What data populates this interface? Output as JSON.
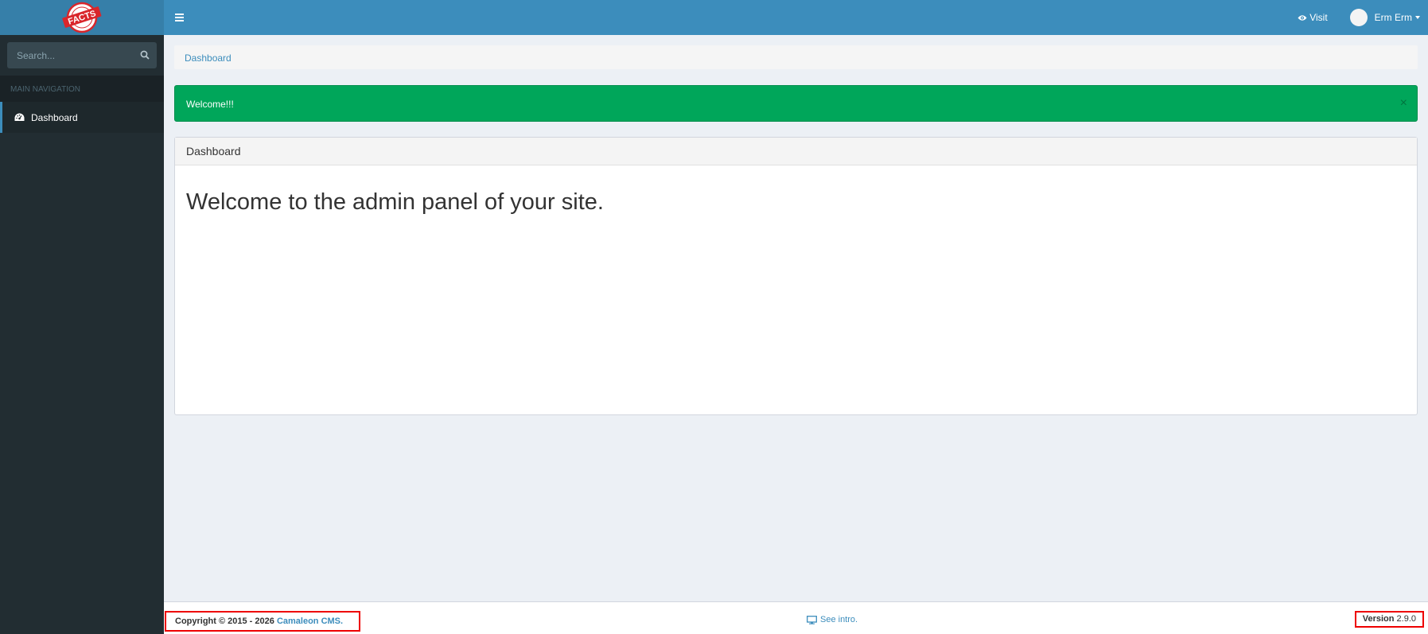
{
  "brand": {
    "logo_text": "FACTS"
  },
  "sidebar": {
    "search_placeholder": "Search...",
    "nav_header": "MAIN NAVIGATION",
    "items": [
      {
        "label": "Dashboard",
        "icon": "dashboard-icon"
      }
    ]
  },
  "header": {
    "visit_label": "Visit",
    "user_name": "Erm Erm"
  },
  "breadcrumb": {
    "item": "Dashboard"
  },
  "alert": {
    "message": "Welcome!!!",
    "close_symbol": "×"
  },
  "panel": {
    "title": "Dashboard",
    "heading": "Welcome to the admin panel of your site."
  },
  "footer": {
    "copyright_prefix": "Copyright © 2015 - 2026 ",
    "cms_link": "Camaleon CMS.",
    "intro_label": "See intro.",
    "version_label": "Version",
    "version_value": "2.9.0"
  },
  "colors": {
    "header_blue": "#3c8dbc",
    "sidebar_dark": "#222d32",
    "alert_green": "#00a65a",
    "highlight_red": "#ee0000"
  }
}
